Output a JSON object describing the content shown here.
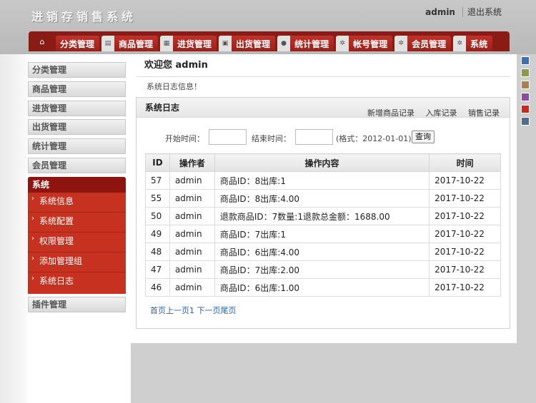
{
  "header": {
    "title": "进销存销售系统",
    "user": "admin",
    "logout": "退出系统"
  },
  "nav": {
    "home_icon": "home-icon",
    "tabs": [
      {
        "label": "分类管理",
        "icon": ""
      },
      {
        "label": "商品管理",
        "icon": "▤"
      },
      {
        "label": "进货管理",
        "icon": "▦"
      },
      {
        "label": "出货管理",
        "icon": "▣"
      },
      {
        "label": "统计管理",
        "icon": "●"
      },
      {
        "label": "帐号管理",
        "icon": "✲"
      },
      {
        "label": "会员管理",
        "icon": "✲"
      },
      {
        "label": "系统",
        "icon": "✲"
      }
    ]
  },
  "sidebar": {
    "items": [
      "分类管理",
      "商品管理",
      "进货管理",
      "出货管理",
      "统计管理",
      "会员管理"
    ],
    "system_title": "系统",
    "system_items": [
      "系统信息",
      "系统配置",
      "权限管理",
      "添加管理组",
      "系统日志"
    ],
    "plugin": "插件管理"
  },
  "main": {
    "welcome": "欢迎您 admin",
    "notice": "系统日志信息！",
    "panel_title": "系统日志",
    "panel_links": [
      "新增商品记录",
      "入库记录",
      "销售记录"
    ],
    "filter": {
      "start_label": "开始时间：",
      "end_label": "结束时间：",
      "format_hint": "(格式：2012-01-01)",
      "query_button": "查询"
    },
    "table": {
      "headers": [
        "ID",
        "操作者",
        "操作内容",
        "时间"
      ],
      "rows": [
        [
          "57",
          "admin",
          "商品ID：8出库:1",
          "2017-10-22"
        ],
        [
          "55",
          "admin",
          "商品ID：8出库:4.00",
          "2017-10-22"
        ],
        [
          "50",
          "admin",
          "退款商品ID：7数量:1退款总金额：1688.00",
          "2017-10-22"
        ],
        [
          "49",
          "admin",
          "商品ID：7出库:1",
          "2017-10-22"
        ],
        [
          "48",
          "admin",
          "商品ID：6出库:4.00",
          "2017-10-22"
        ],
        [
          "47",
          "admin",
          "商品ID：7出库:2.00",
          "2017-10-22"
        ],
        [
          "46",
          "admin",
          "商品ID：6出库:1.00",
          "2017-10-22"
        ]
      ]
    },
    "pager": "首页上一页1 下一页尾页"
  },
  "colors": {
    "brand_red": "#8a1c16",
    "tab_red": "#c0322a",
    "swatches": [
      "#3f6fae",
      "#8a9a4c",
      "#a8824e",
      "#8e4b9b",
      "#c42a1e",
      "#536c8c"
    ]
  }
}
